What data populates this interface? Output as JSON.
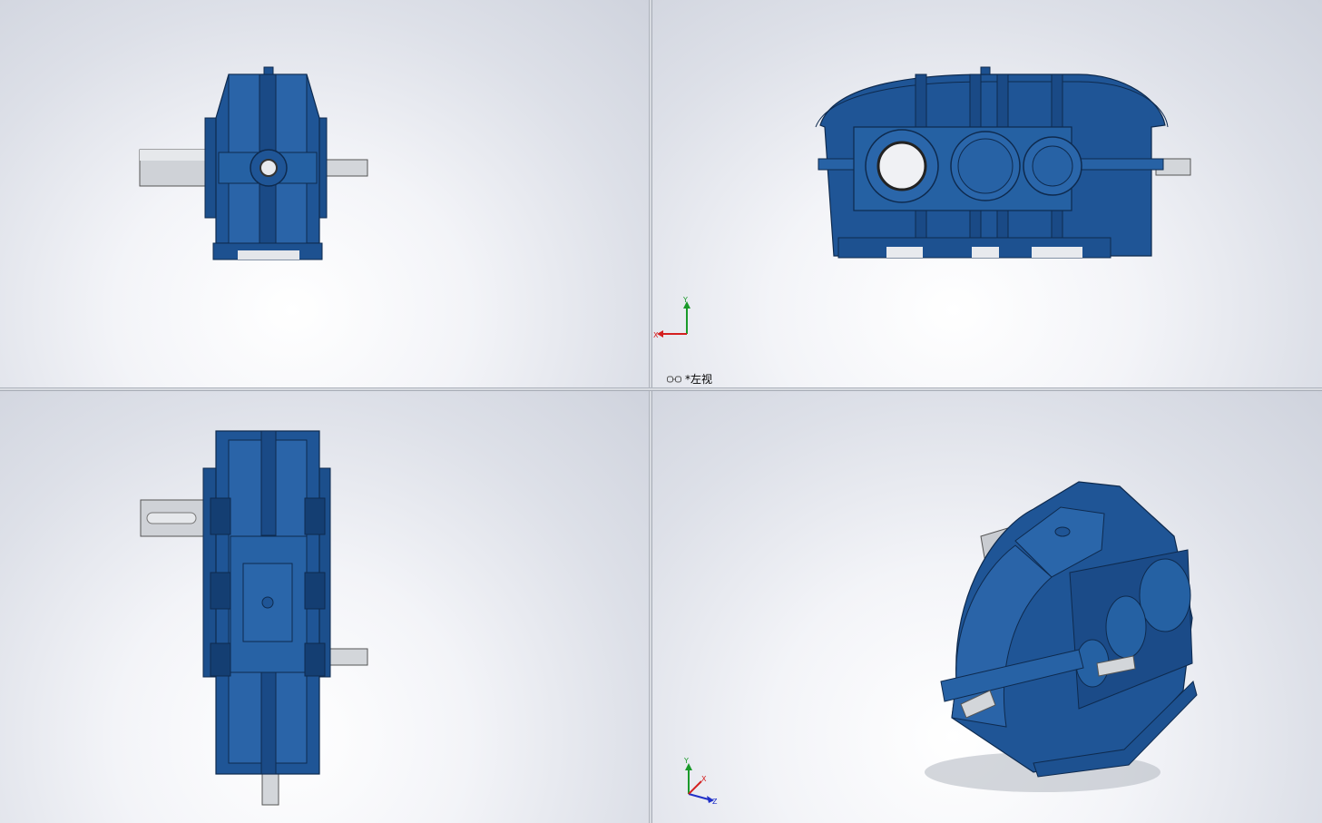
{
  "viewports": {
    "top_right": {
      "label": "*左视",
      "axes": {
        "vertical": "Y",
        "horizontal": "X"
      }
    },
    "bottom_right": {
      "axes": {
        "vertical": "Y",
        "horizontal": "X",
        "depth": "Z"
      }
    }
  },
  "colors": {
    "housing_blue": "#1f5596",
    "housing_dark": "#143e72",
    "housing_light": "#3a74b8",
    "shaft_grey": "#c9ccd1",
    "axis_x": "#d42020",
    "axis_y": "#1a9a2a",
    "axis_z": "#2030c8"
  },
  "icons": [
    "view-glasses-icon",
    "triad-icon"
  ]
}
